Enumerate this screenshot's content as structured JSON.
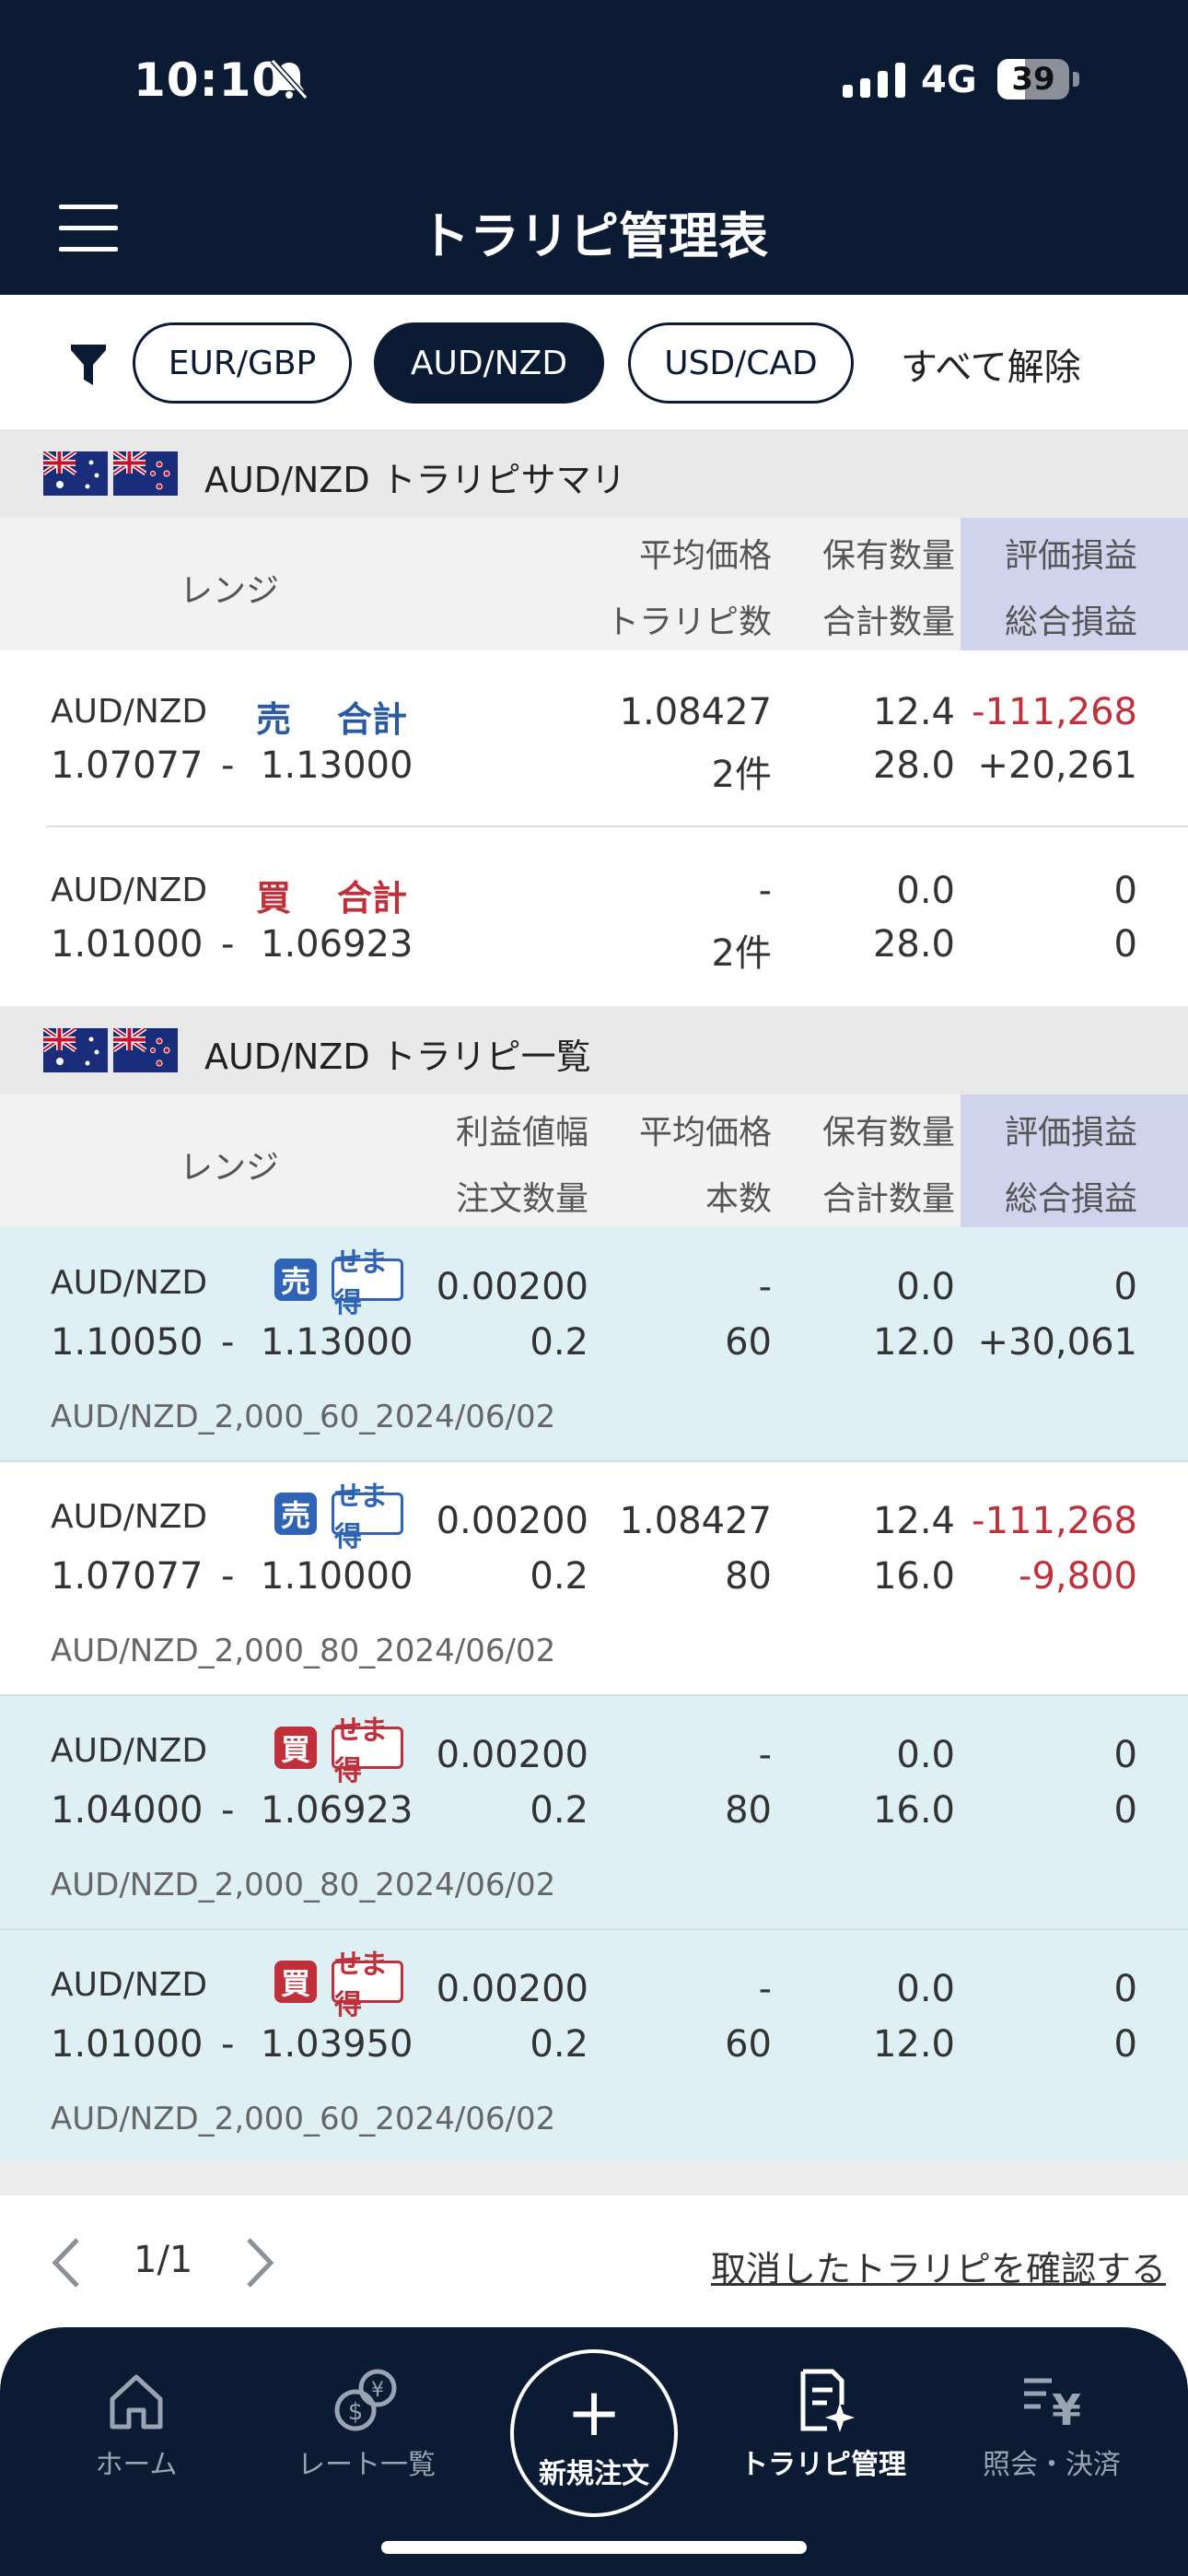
{
  "status_bar": {
    "time": "10:10",
    "network": "4G",
    "battery": "39"
  },
  "header": {
    "title": "トラリピ管理表"
  },
  "filters": {
    "chips": [
      "EUR/GBP",
      "AUD/NZD",
      "USD/CAD"
    ],
    "active": "AUD/NZD",
    "clear_all": "すべて解除"
  },
  "summary": {
    "title": "AUD/NZD トラリピサマリ",
    "headers": {
      "range": "レンジ",
      "avg_price": "平均価格",
      "trap_count": "トラリピ数",
      "holding": "保有数量",
      "total_qty": "合計数量",
      "unrealized": "評価損益",
      "total_pl": "総合損益"
    },
    "rows": [
      {
        "pair": "AUD/NZD",
        "side": "売",
        "total_label": "合計",
        "range_low": "1.07077",
        "sep": "-",
        "range_high": "1.13000",
        "avg_price": "1.08427",
        "trap_count": "2件",
        "holding": "12.4",
        "total_qty": "28.0",
        "unrealized": "-111,268",
        "total_pl": "+20,261"
      },
      {
        "pair": "AUD/NZD",
        "side": "買",
        "total_label": "合計",
        "range_low": "1.01000",
        "sep": "-",
        "range_high": "1.06923",
        "avg_price": "-",
        "trap_count": "2件",
        "holding": "0.0",
        "total_qty": "28.0",
        "unrealized": "0",
        "total_pl": "0"
      }
    ]
  },
  "list": {
    "title": "AUD/NZD トラリピ一覧",
    "headers": {
      "range": "レンジ",
      "profit_width": "利益値幅",
      "order_qty": "注文数量",
      "avg_price": "平均価格",
      "count": "本数",
      "holding": "保有数量",
      "total_qty": "合計数量",
      "unrealized": "評価損益",
      "total_pl": "総合損益"
    },
    "badge2_label": "せま得",
    "rows": [
      {
        "pair": "AUD/NZD",
        "side": "売",
        "range_low": "1.10050",
        "sep": "-",
        "range_high": "1.13000",
        "profit_width": "0.00200",
        "order_qty": "0.2",
        "avg_price": "-",
        "count": "60",
        "holding": "0.0",
        "total_qty": "12.0",
        "unrealized": "0",
        "total_pl": "+30,061",
        "name": "AUD/NZD_2,000_60_2024/06/02"
      },
      {
        "pair": "AUD/NZD",
        "side": "売",
        "range_low": "1.07077",
        "sep": "-",
        "range_high": "1.10000",
        "profit_width": "0.00200",
        "order_qty": "0.2",
        "avg_price": "1.08427",
        "count": "80",
        "holding": "12.4",
        "total_qty": "16.0",
        "unrealized": "-111,268",
        "total_pl": "-9,800",
        "name": "AUD/NZD_2,000_80_2024/06/02"
      },
      {
        "pair": "AUD/NZD",
        "side": "買",
        "range_low": "1.04000",
        "sep": "-",
        "range_high": "1.06923",
        "profit_width": "0.00200",
        "order_qty": "0.2",
        "avg_price": "-",
        "count": "80",
        "holding": "0.0",
        "total_qty": "16.0",
        "unrealized": "0",
        "total_pl": "0",
        "name": "AUD/NZD_2,000_80_2024/06/02"
      },
      {
        "pair": "AUD/NZD",
        "side": "買",
        "range_low": "1.01000",
        "sep": "-",
        "range_high": "1.03950",
        "profit_width": "0.00200",
        "order_qty": "0.2",
        "avg_price": "-",
        "count": "60",
        "holding": "0.0",
        "total_qty": "12.0",
        "unrealized": "0",
        "total_pl": "0",
        "name": "AUD/NZD_2,000_60_2024/06/02"
      }
    ]
  },
  "pager": {
    "page": "1/1",
    "cancelled_link": "取消したトラリピを確認する"
  },
  "bottom_nav": {
    "home": "ホーム",
    "rates": "レート一覧",
    "new_order": "新規注文",
    "manage": "トラリピ管理",
    "inquiry": "照会・決済"
  },
  "colors": {
    "navy": "#0b1b33",
    "sell_blue": "#2f63b5",
    "buy_red": "#c0303a",
    "loss_red": "#c0303a",
    "row_highlight": "#def0f4",
    "pl_header": "#cfd3ec"
  }
}
